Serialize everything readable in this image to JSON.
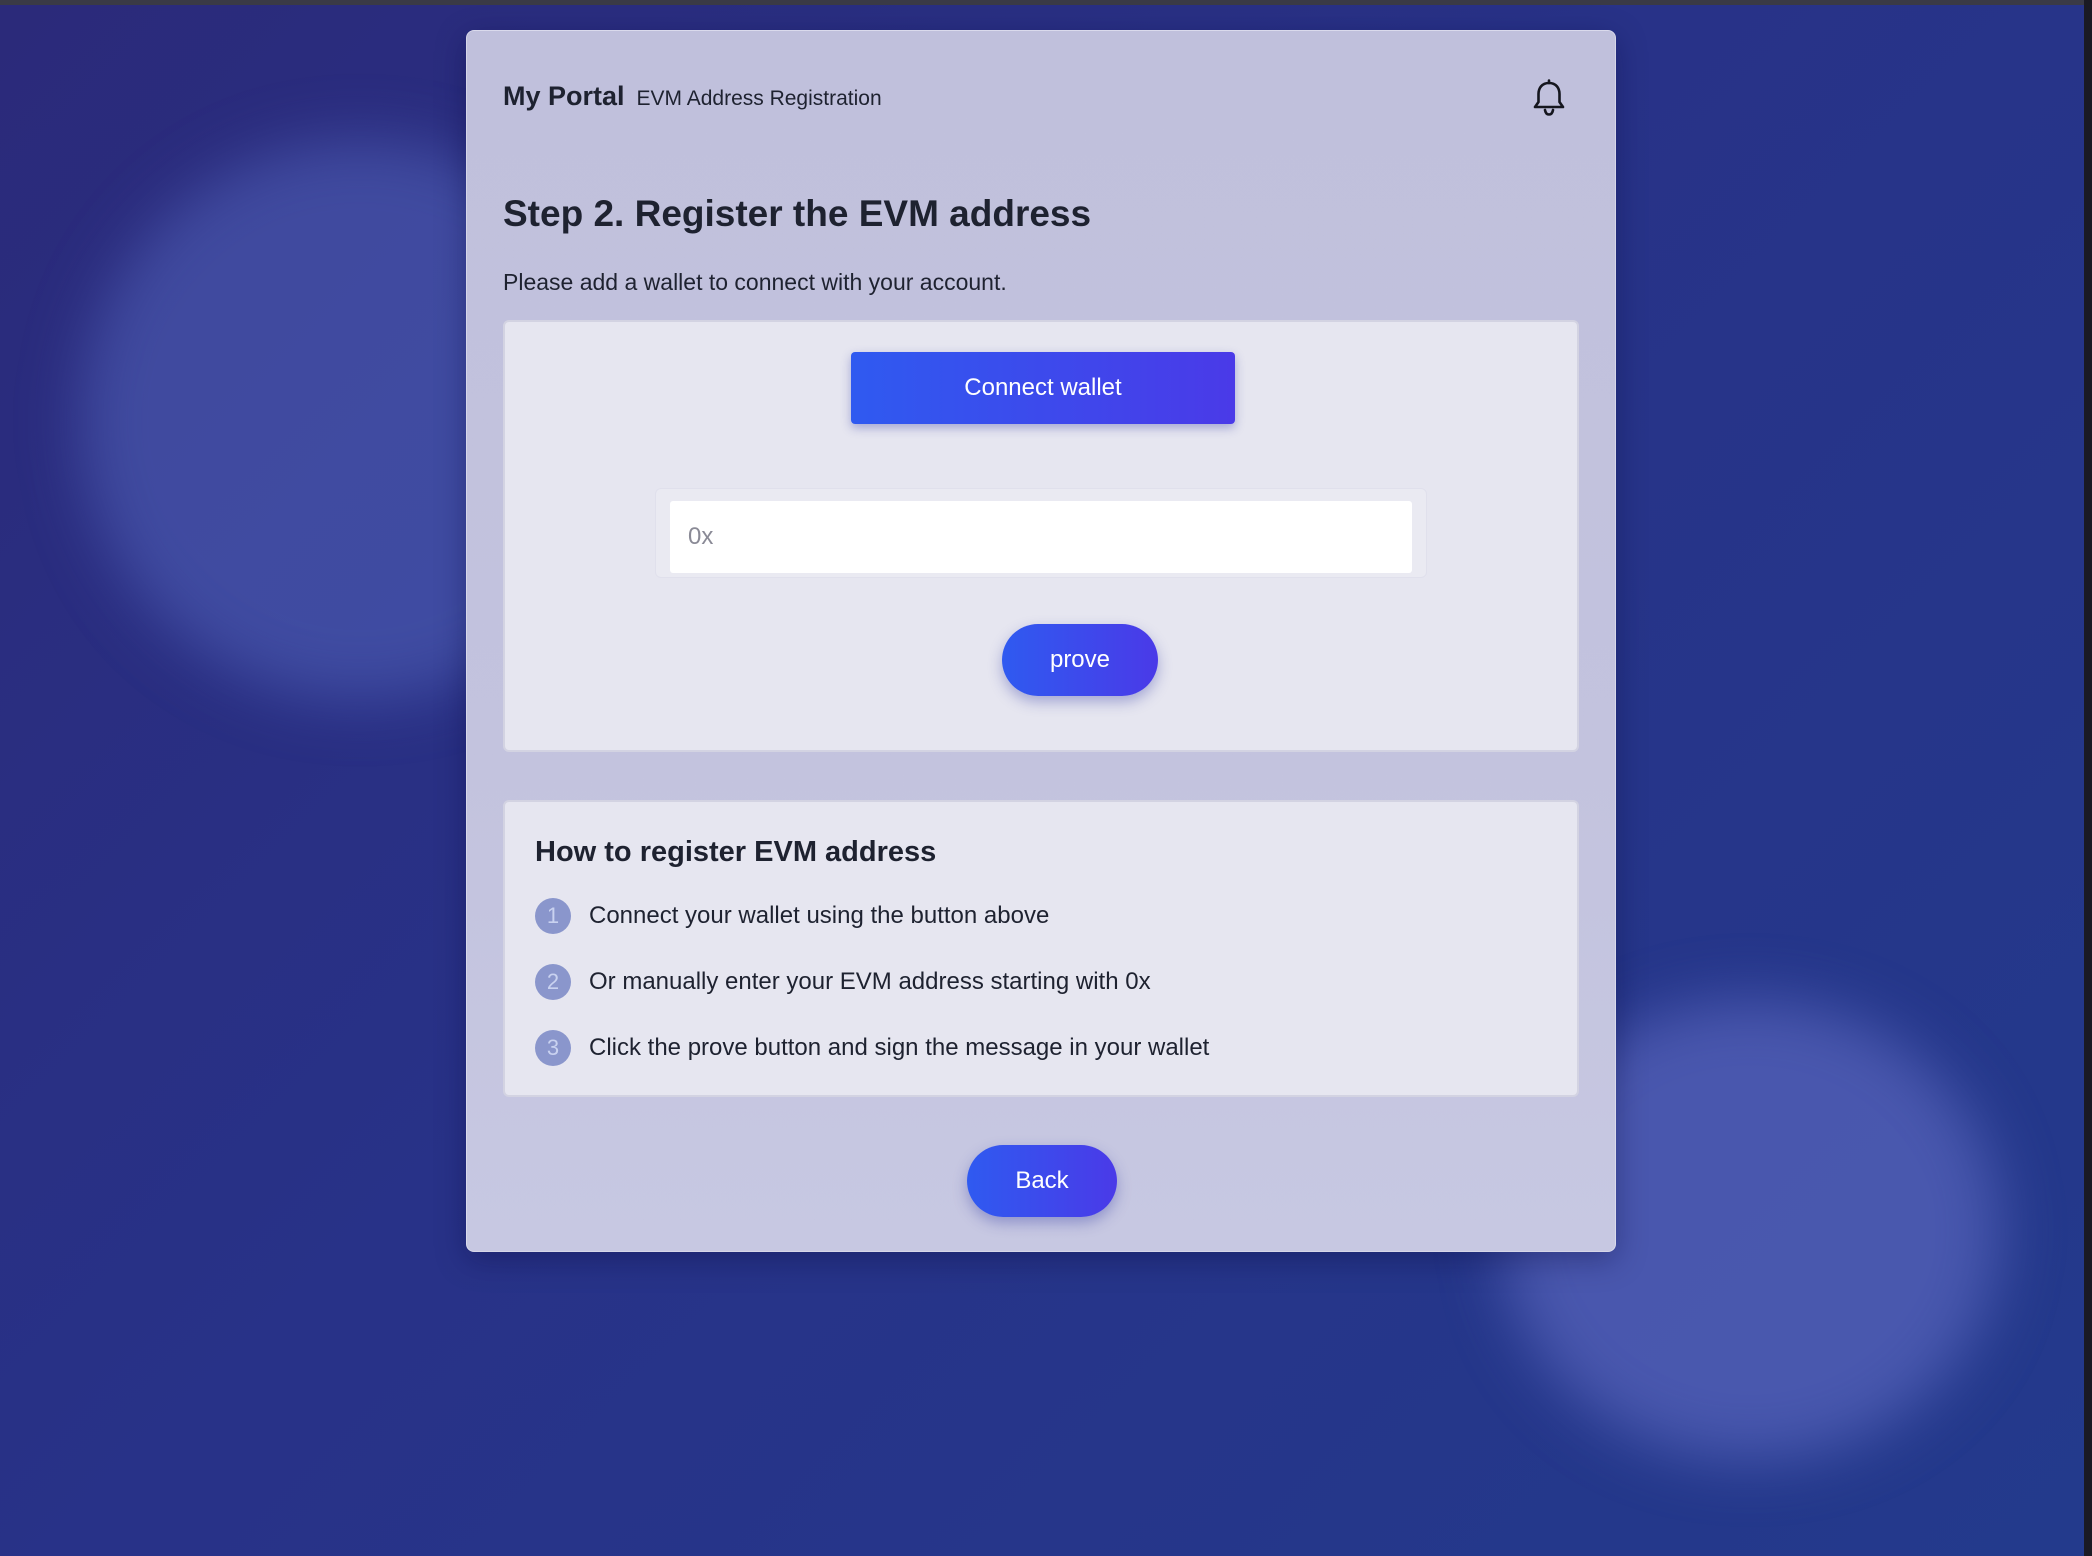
{
  "header": {
    "brand": "My Portal",
    "subtitle": "EVM Address Registration",
    "notification_icon": "bell-icon"
  },
  "page": {
    "title": "Step 2. Register the EVM address",
    "description": "Please add a wallet to connect with your account."
  },
  "connect": {
    "connect_wallet_label": "Connect wallet",
    "address_input": {
      "placeholder": "0x",
      "value": ""
    },
    "prove_label": "prove"
  },
  "howto": {
    "title": "How to register EVM address",
    "steps": [
      {
        "number": "1",
        "text": "Connect your wallet using the button above"
      },
      {
        "number": "2",
        "text": "Or manually enter your EVM address starting with 0x"
      },
      {
        "number": "3",
        "text": "Click the prove button and sign the message in your wallet"
      }
    ]
  },
  "footer": {
    "back_label": "Back"
  },
  "colors": {
    "background": "#283288",
    "card": "#c3c3de",
    "panel": "#e6e6f0",
    "button_start": "#2f5af0",
    "button_end": "#4a3ae8",
    "step_badge": "#8a96cc",
    "text": "#1e2230"
  }
}
